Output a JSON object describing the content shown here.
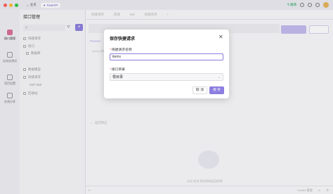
{
  "titlebar": {
    "home_label": "主页",
    "tab_label": "FastAPI",
    "invite_label": "邀请"
  },
  "leftnav": {
    "items": [
      {
        "label": "接口管理",
        "active": true
      },
      {
        "label": "自动化测试",
        "active": false
      },
      {
        "label": "项目设置",
        "active": false
      },
      {
        "label": "在线分享",
        "active": false
      }
    ]
  },
  "tree": {
    "title": "接口管理",
    "search_placeholder": "",
    "add_label": "+",
    "rows": [
      {
        "label": "快捷请求"
      },
      {
        "label": "接口"
      },
      {
        "label": "数据库"
      },
      {
        "label": "数据模型"
      },
      {
        "label": "快捷请求"
      },
      {
        "label": "GET  Bal"
      },
      {
        "label": "回收站"
      }
    ]
  },
  "main": {
    "tabs": [
      "快捷请求",
      "新建",
      "Bal",
      "快捷请求",
      "+"
    ],
    "params_tab": "Params",
    "query_label": "Query 参数",
    "response_label": "返回响应",
    "empty_text": "点击\"发送\"按钮获取返回结果",
    "footer_right": [
      "Cookie 管理"
    ]
  },
  "modal": {
    "title": "保存快捷请求",
    "name_label": "快捷请求名称",
    "name_value": "items",
    "dir_label": "接口目录",
    "dir_value": "根目录",
    "cancel_label": "取 消",
    "save_label": "保 存"
  },
  "colors": {
    "accent": "#8b7ee0",
    "required": "#e5484d",
    "invite": "#19a35a"
  }
}
